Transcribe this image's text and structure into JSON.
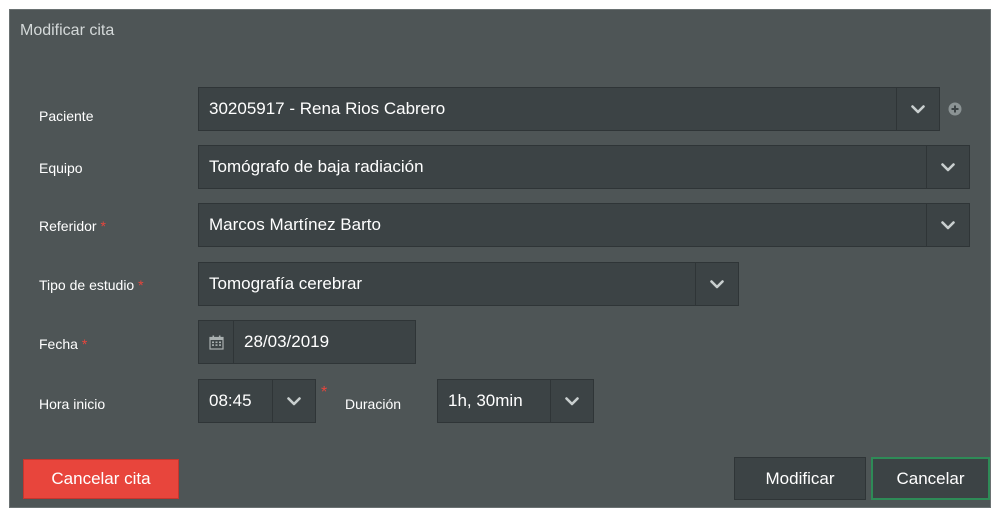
{
  "dialog": {
    "title": "Modificar cita"
  },
  "form": {
    "paciente": {
      "label": "Paciente",
      "value": "30205917 - Rena Rios Cabrero"
    },
    "equipo": {
      "label": "Equipo",
      "value": "Tomógrafo de baja radiación"
    },
    "referidor": {
      "label": "Referidor",
      "required": "*",
      "value": "Marcos Martínez Barto"
    },
    "tipo_estudio": {
      "label": "Tipo de estudio",
      "required": "*",
      "value": "Tomografía cerebrar"
    },
    "fecha": {
      "label": "Fecha",
      "required": "*",
      "value": "28/03/2019"
    },
    "hora_inicio": {
      "label": "Hora inicio",
      "value": "08:45",
      "required": "*"
    },
    "duracion": {
      "label": "Duración",
      "value": "1h, 30min"
    }
  },
  "buttons": {
    "cancel_appointment": "Cancelar cita",
    "modify": "Modificar",
    "cancel": "Cancelar"
  },
  "icons": {
    "dropdown": "chevron-down-icon",
    "add": "plus-circle-icon",
    "calendar": "calendar-icon"
  },
  "colors": {
    "dialog_bg": "#4e5556",
    "field_bg": "#3c4345",
    "danger": "#e8453c",
    "accent_border": "#2e8b57"
  }
}
